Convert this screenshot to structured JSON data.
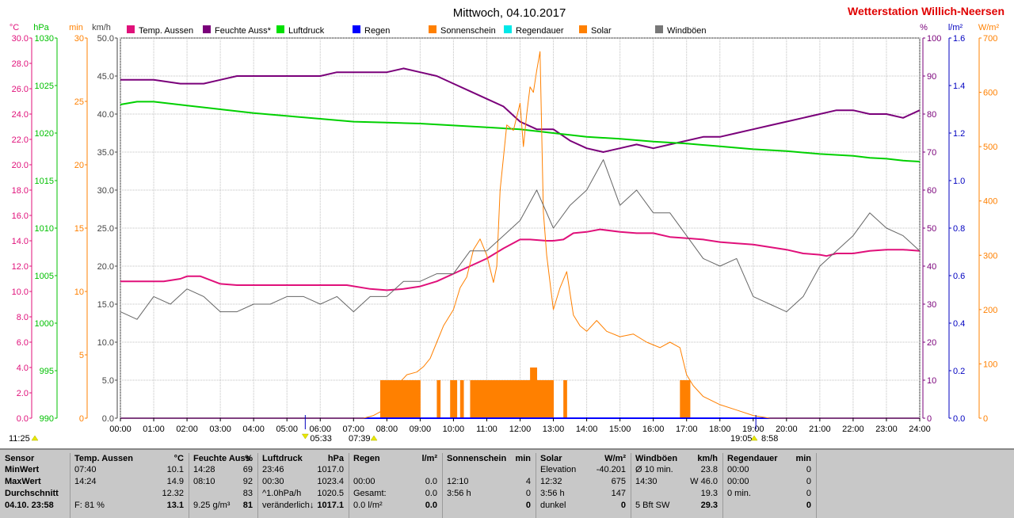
{
  "header": {
    "date_title": "Mittwoch, 04.10.2017",
    "station_title": "Wetterstation Willich-Neersen",
    "station_color": "#e00000"
  },
  "axis_units": {
    "celsius": "°C",
    "hpa": "hPa",
    "min": "min",
    "kmh": "km/h",
    "percent": "%",
    "lm2": "l/m²",
    "wm2": "W/m²"
  },
  "legend": [
    {
      "label": "Temp. Aussen",
      "color": "#e0107a"
    },
    {
      "label": "Feuchte Auss*",
      "color": "#7a007a"
    },
    {
      "label": "Luftdruck",
      "color": "#00e000"
    },
    {
      "label": "Regen",
      "color": "#0000ff"
    },
    {
      "label": "Sonnenschein",
      "color": "#ff8000"
    },
    {
      "label": "Regendauer",
      "color": "#00e8e8"
    },
    {
      "label": "Solar",
      "color": "#ff8000"
    },
    {
      "label": "Windböen",
      "color": "#777777"
    }
  ],
  "time_marks": {
    "start": "11:25",
    "sunrise": "05:33",
    "dawn": "07:39",
    "sunset": "19:05",
    "daylength": "8:58"
  },
  "chart_data": {
    "type": "line",
    "x_ticks": [
      "00:00",
      "01:00",
      "02:00",
      "03:00",
      "04:00",
      "05:00",
      "06:00",
      "07:00",
      "08:00",
      "09:00",
      "10:00",
      "11:00",
      "12:00",
      "13:00",
      "14:00",
      "15:00",
      "16:00",
      "17:00",
      "18:00",
      "19:00",
      "20:00",
      "21:00",
      "22:00",
      "23:00",
      "24:00"
    ],
    "axes": {
      "temp_c": {
        "ticks": [
          "0.0",
          "2.0",
          "4.0",
          "6.0",
          "8.0",
          "10.0",
          "12.0",
          "14.0",
          "16.0",
          "18.0",
          "20.0",
          "22.0",
          "24.0",
          "26.0",
          "28.0",
          "30.0"
        ],
        "range": [
          0,
          30
        ],
        "color": "#e0107a"
      },
      "pressure_hpa": {
        "ticks": [
          "990",
          "995",
          "1000",
          "1005",
          "1010",
          "1015",
          "1020",
          "1025",
          "1030"
        ],
        "range": [
          990,
          1030
        ],
        "color": "#00c000"
      },
      "sunshine_min": {
        "ticks": [
          "0",
          "5",
          "10",
          "15",
          "20",
          "25",
          "30"
        ],
        "range": [
          0,
          30
        ],
        "color": "#ff8000"
      },
      "wind_kmh": {
        "ticks": [
          "0.0",
          "5.0",
          "10.0",
          "15.0",
          "20.0",
          "25.0",
          "30.0",
          "35.0",
          "40.0",
          "45.0",
          "50.0"
        ],
        "range": [
          0,
          50
        ],
        "color": "#444444"
      },
      "humidity_pct": {
        "ticks": [
          "0",
          "10",
          "20",
          "30",
          "40",
          "50",
          "60",
          "70",
          "80",
          "90",
          "100"
        ],
        "range": [
          0,
          100
        ],
        "color": "#7a007a"
      },
      "rain_lm2": {
        "ticks": [
          "0.0",
          "0.2",
          "0.4",
          "0.6",
          "0.8",
          "1.0",
          "1.2",
          "1.4",
          "1.6"
        ],
        "range": [
          0,
          1.6
        ],
        "color": "#0000c0"
      },
      "solar_wm2": {
        "ticks": [
          "0",
          "100",
          "200",
          "300",
          "400",
          "500",
          "600",
          "700"
        ],
        "range": [
          0,
          700
        ],
        "color": "#ff8000"
      }
    },
    "series": [
      {
        "name": "Temp. Aussen",
        "axis": "temp_c",
        "color": "#e0107a",
        "x": [
          0,
          1,
          1.3,
          1.8,
          2.0,
          2.4,
          3.0,
          3.5,
          4.0,
          5.0,
          6.0,
          6.8,
          7.5,
          8.0,
          8.5,
          9.0,
          9.5,
          10.0,
          10.5,
          11.0,
          11.5,
          12.0,
          12.3,
          12.8,
          13.0,
          13.3,
          13.6,
          14.0,
          14.4,
          15.0,
          15.5,
          16.0,
          16.5,
          17.0,
          17.5,
          18.0,
          18.5,
          19.0,
          19.5,
          20.0,
          20.5,
          21.0,
          21.2,
          21.5,
          22.0,
          22.5,
          23.0,
          23.5,
          24.0
        ],
        "y": [
          10.8,
          10.8,
          10.8,
          11.0,
          11.2,
          11.2,
          10.6,
          10.5,
          10.5,
          10.5,
          10.5,
          10.5,
          10.2,
          10.1,
          10.2,
          10.4,
          10.8,
          11.4,
          12.0,
          12.6,
          13.4,
          14.1,
          14.1,
          14.0,
          14.0,
          14.1,
          14.6,
          14.7,
          14.9,
          14.7,
          14.6,
          14.6,
          14.3,
          14.2,
          14.1,
          13.9,
          13.8,
          13.7,
          13.5,
          13.3,
          13.0,
          12.9,
          12.8,
          13.0,
          13.0,
          13.2,
          13.3,
          13.3,
          13.2
        ]
      },
      {
        "name": "Feuchte Auss*",
        "axis": "humidity_pct",
        "color": "#7a007a",
        "x": [
          0,
          1,
          1.8,
          2.5,
          3.0,
          3.5,
          4.0,
          5.0,
          6.0,
          6.5,
          7.0,
          7.5,
          8.0,
          8.5,
          9.0,
          9.5,
          10.0,
          10.5,
          11.0,
          11.5,
          12.0,
          12.5,
          13.0,
          13.5,
          14.0,
          14.5,
          15.0,
          15.5,
          16.0,
          16.5,
          17.0,
          17.5,
          18.0,
          18.5,
          19.0,
          19.5,
          20.0,
          20.5,
          21.0,
          21.5,
          22.0,
          22.5,
          23.0,
          23.5,
          24.0
        ],
        "y": [
          89,
          89,
          88,
          88,
          89,
          90,
          90,
          90,
          90,
          91,
          91,
          91,
          91,
          92,
          91,
          90,
          88,
          86,
          84,
          82,
          78,
          76,
          76,
          73,
          71,
          70,
          71,
          72,
          71,
          72,
          73,
          74,
          74,
          75,
          76,
          77,
          78,
          79,
          80,
          81,
          81,
          80,
          80,
          79,
          81
        ]
      },
      {
        "name": "Luftdruck",
        "axis": "pressure_hpa",
        "color": "#00d000",
        "x": [
          0,
          0.5,
          1.0,
          2.0,
          3.0,
          4.0,
          5.0,
          6.0,
          7.0,
          8.0,
          9.0,
          10.0,
          11.0,
          12.0,
          12.5,
          13.0,
          14.0,
          15.0,
          16.0,
          17.0,
          18.0,
          19.0,
          20.0,
          21.0,
          22.0,
          22.5,
          23.0,
          23.5,
          24.0
        ],
        "y": [
          1023.0,
          1023.3,
          1023.3,
          1022.9,
          1022.5,
          1022.1,
          1021.8,
          1021.5,
          1021.2,
          1021.1,
          1021.0,
          1020.8,
          1020.6,
          1020.4,
          1020.2,
          1020.0,
          1019.6,
          1019.4,
          1019.1,
          1018.9,
          1018.6,
          1018.3,
          1018.1,
          1017.8,
          1017.6,
          1017.4,
          1017.3,
          1017.1,
          1017.0
        ]
      },
      {
        "name": "Regen",
        "axis": "rain_lm2",
        "color": "#0000ff",
        "x": [
          0,
          24
        ],
        "y": [
          0.0,
          0.0
        ]
      },
      {
        "name": "Solar",
        "axis": "solar_wm2",
        "color": "#ff8000",
        "x": [
          0,
          7.3,
          7.6,
          7.9,
          8.0,
          8.3,
          8.6,
          8.9,
          9.1,
          9.3,
          9.5,
          9.7,
          9.9,
          10.0,
          10.2,
          10.4,
          10.6,
          10.8,
          11.0,
          11.2,
          11.3,
          11.4,
          11.5,
          11.6,
          11.8,
          12.0,
          12.1,
          12.2,
          12.3,
          12.4,
          12.5,
          12.6,
          12.7,
          12.8,
          12.9,
          13.0,
          13.2,
          13.4,
          13.6,
          13.8,
          14.0,
          14.3,
          14.6,
          15.0,
          15.4,
          15.8,
          16.2,
          16.5,
          16.8,
          17.0,
          17.2,
          17.5,
          18.0,
          18.5,
          19.0,
          19.5,
          24.0
        ],
        "y": [
          0,
          0,
          5,
          15,
          30,
          60,
          80,
          85,
          95,
          110,
          140,
          170,
          190,
          200,
          240,
          260,
          310,
          330,
          300,
          250,
          280,
          420,
          480,
          540,
          530,
          580,
          500,
          560,
          610,
          600,
          640,
          675,
          380,
          300,
          250,
          200,
          240,
          270,
          190,
          170,
          160,
          180,
          160,
          150,
          155,
          140,
          130,
          140,
          130,
          80,
          60,
          40,
          25,
          15,
          5,
          0,
          0
        ]
      },
      {
        "name": "Windböen",
        "axis": "wind_kmh",
        "color": "#666666",
        "x": [
          0,
          0.5,
          1.0,
          1.5,
          2.0,
          2.5,
          3.0,
          3.5,
          4.0,
          4.5,
          5.0,
          5.5,
          6.0,
          6.5,
          7.0,
          7.5,
          8.0,
          8.5,
          9.0,
          9.5,
          10.0,
          10.5,
          11.0,
          11.5,
          12.0,
          12.5,
          13.0,
          13.5,
          14.0,
          14.5,
          15.0,
          15.5,
          16.0,
          16.5,
          17.0,
          17.5,
          18.0,
          18.5,
          19.0,
          19.5,
          20.0,
          20.5,
          21.0,
          21.5,
          22.0,
          22.5,
          23.0,
          23.5,
          24.0
        ],
        "y": [
          14,
          13,
          16,
          15,
          17,
          16,
          14,
          14,
          15,
          15,
          16,
          16,
          15,
          16,
          14,
          16,
          16,
          18,
          18,
          19,
          19,
          22,
          22,
          24,
          26,
          30,
          25,
          28,
          30,
          34,
          28,
          30,
          27,
          27,
          24,
          21,
          20,
          21,
          16,
          15,
          14,
          16,
          20,
          22,
          24,
          27,
          25,
          24,
          22
        ]
      }
    ],
    "bars": [
      {
        "name": "Sonnenschein",
        "axis": "sunshine_min",
        "color": "#ff8000",
        "x": [
          7.8,
          7.9,
          8.0,
          8.1,
          8.2,
          8.3,
          8.4,
          8.5,
          8.6,
          8.7,
          8.8,
          8.9,
          9.5,
          9.9,
          10.0,
          10.2,
          10.5,
          10.6,
          10.7,
          10.8,
          10.9,
          11.0,
          11.1,
          11.2,
          11.3,
          11.4,
          11.5,
          11.6,
          11.7,
          11.8,
          11.9,
          12.0,
          12.1,
          12.2,
          12.3,
          12.4,
          12.5,
          12.6,
          12.7,
          12.8,
          12.9,
          13.3,
          16.8,
          16.9,
          17.0
        ],
        "y": [
          3,
          3,
          3,
          3,
          3,
          3,
          3,
          3,
          3,
          3,
          3,
          3,
          3,
          3,
          3,
          3,
          3,
          3,
          3,
          3,
          3,
          3,
          3,
          3,
          3,
          3,
          3,
          3,
          3,
          3,
          3,
          3,
          3,
          3,
          4,
          4,
          3,
          3,
          3,
          3,
          3,
          3,
          3,
          3,
          3
        ]
      }
    ]
  },
  "table": {
    "rows_labels": {
      "min": "MinWert",
      "max": "MaxWert",
      "avg": "Durchschnitt",
      "date": "04.10. 23:58"
    },
    "sensor_header": "Sensor",
    "columns": [
      {
        "title": "Temp. Aussen",
        "unit": "°C",
        "rows": [
          [
            "07:40",
            "10.1"
          ],
          [
            "14:24",
            "14.9"
          ],
          [
            "",
            "12.32"
          ],
          [
            "F: 81 %",
            "13.1"
          ]
        ]
      },
      {
        "title": "Feuchte Auss",
        "unit": "%",
        "rows": [
          [
            "14:28",
            "69"
          ],
          [
            "08:10",
            "92"
          ],
          [
            "",
            "83"
          ],
          [
            "9.25 g/m³",
            "81"
          ]
        ]
      },
      {
        "title": "Luftdruck",
        "unit": "hPa",
        "rows": [
          [
            "23:46",
            "1017.0"
          ],
          [
            "00:30",
            "1023.4"
          ],
          [
            "^1.0hPa/h",
            "1020.5"
          ],
          [
            "veränderlich↓",
            "1017.1"
          ]
        ]
      },
      {
        "title": "Regen",
        "unit": "l/m²",
        "rows": [
          [
            "",
            ""
          ],
          [
            "00:00",
            "0.0"
          ],
          [
            "Gesamt:",
            "0.0"
          ],
          [
            "0.0 l/m²",
            "0.0"
          ]
        ]
      },
      {
        "title": "Sonnenschein",
        "unit": "min",
        "rows": [
          [
            "",
            ""
          ],
          [
            "12:10",
            "4"
          ],
          [
            "3:56 h",
            "0"
          ],
          [
            "",
            "0"
          ]
        ]
      },
      {
        "title": "Solar",
        "unit": "W/m²",
        "rows": [
          [
            "Elevation",
            "-40.201"
          ],
          [
            "12:32",
            "675"
          ],
          [
            "3:56 h",
            "147"
          ],
          [
            "dunkel",
            "0"
          ]
        ]
      },
      {
        "title": "Windböen",
        "unit": "km/h",
        "rows": [
          [
            "Ø 10 min.",
            "23.8"
          ],
          [
            "14:30",
            "W 46.0"
          ],
          [
            "",
            "19.3"
          ],
          [
            "5 Bft SW",
            "29.3"
          ]
        ]
      },
      {
        "title": "Regendauer",
        "unit": "min",
        "rows": [
          [
            "00:00",
            "0"
          ],
          [
            "00:00",
            "0"
          ],
          [
            "0 min.",
            "0"
          ],
          [
            "",
            "0"
          ]
        ]
      }
    ]
  }
}
